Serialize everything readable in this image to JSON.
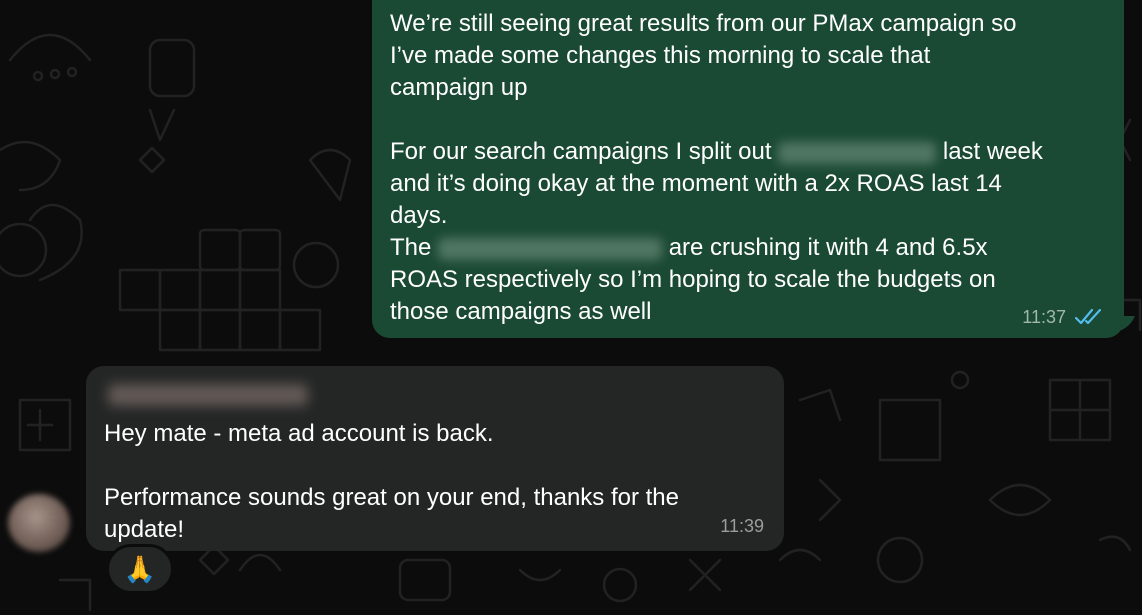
{
  "outgoing_message": {
    "lines": [
      "We’re still seeing great results from our PMax campaign so",
      "I’ve made some changes this morning to scale that",
      "campaign up",
      "",
      "For our search campaigns I split out",
      "last week",
      "and it’s doing okay at the moment with a 2x ROAS last 14",
      "days.",
      "The",
      "are crushing it with 4 and 6.5x",
      "ROAS respectively so I’m hoping to scale the budgets on",
      "those campaigns as well"
    ],
    "time": "11:37",
    "status_icon": "double-check-read-icon",
    "colors": {
      "bubble": "#1b4a34",
      "ticks": "#53bdeb"
    }
  },
  "incoming_message": {
    "lines": [
      "Hey mate - meta ad account is back.",
      "",
      "Performance sounds great on your end, thanks for the",
      "update!"
    ],
    "time": "11:39",
    "reaction": "🙏",
    "colors": {
      "bubble": "#242626"
    }
  }
}
